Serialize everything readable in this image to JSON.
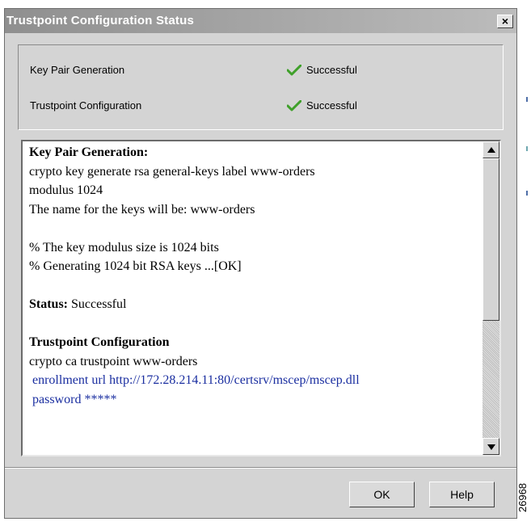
{
  "window": {
    "title": "Trustpoint Configuration Status",
    "close_label": "×"
  },
  "status": {
    "rows": [
      {
        "label": "Key Pair Generation",
        "value": "Successful",
        "icon": "checkmark-icon"
      },
      {
        "label": "Trustpoint Configuration",
        "value": "Successful",
        "icon": "checkmark-icon"
      }
    ]
  },
  "log": {
    "section1_heading": "Key Pair Generation:",
    "line1": "crypto key generate rsa general-keys label www-orders",
    "line2": "modulus 1024",
    "line3": "The name for the keys will be: www-orders",
    "line4": "% The key modulus size is 1024 bits",
    "line5": "% Generating 1024 bit RSA keys ...[OK]",
    "status_label": "Status:",
    "status_value": " Successful",
    "section2_heading": "Trustpoint Configuration",
    "line6": "crypto ca trustpoint www-orders",
    "line7": " enrollment url http://172.28.214.11:80/certsrv/mscep/mscep.dll",
    "line8": " password *****"
  },
  "buttons": {
    "ok": "OK",
    "help": "Help"
  },
  "figure_number": "26968",
  "colors": {
    "check_green": "#3fa02a",
    "link_blue": "#1a2ea0",
    "title_gradient_start": "#8f8f8f",
    "dialog_bg": "#d4d4d4"
  }
}
